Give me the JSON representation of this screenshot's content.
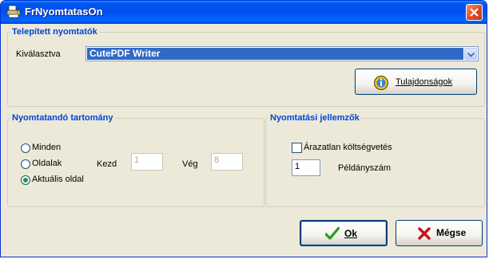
{
  "window": {
    "title": "FrNyomtatasOn"
  },
  "printers_group": {
    "legend": "Telepített nyomtatók",
    "selected_label": "Kiválasztva",
    "selected_printer": "CutePDF Writer",
    "properties_button": "Tulajdonságok"
  },
  "range_group": {
    "legend": "Nyomtatandó tartomány",
    "options": [
      "Minden",
      "Oldalak",
      "Aktuális oldal"
    ],
    "selected_option": "Aktuális oldal",
    "start_label": "Kezd",
    "start_value": "1",
    "end_label": "Vég",
    "end_value": "8"
  },
  "print_props_group": {
    "legend": "Nyomtatási jellemzők",
    "unpriced_budget_label": "Árazatlan költségvetés",
    "unpriced_budget_checked": false,
    "copies_value": "1",
    "copies_label": "Példányszám"
  },
  "buttons": {
    "ok": "Ok",
    "cancel": "Mégse"
  },
  "colors": {
    "title_bar": "#0053ee",
    "legend": "#0046d5",
    "selection": "#316ac5",
    "radio_dot": "#21a121",
    "cancel_x": "#c0141b",
    "ok_check": "#2b9a1e"
  }
}
